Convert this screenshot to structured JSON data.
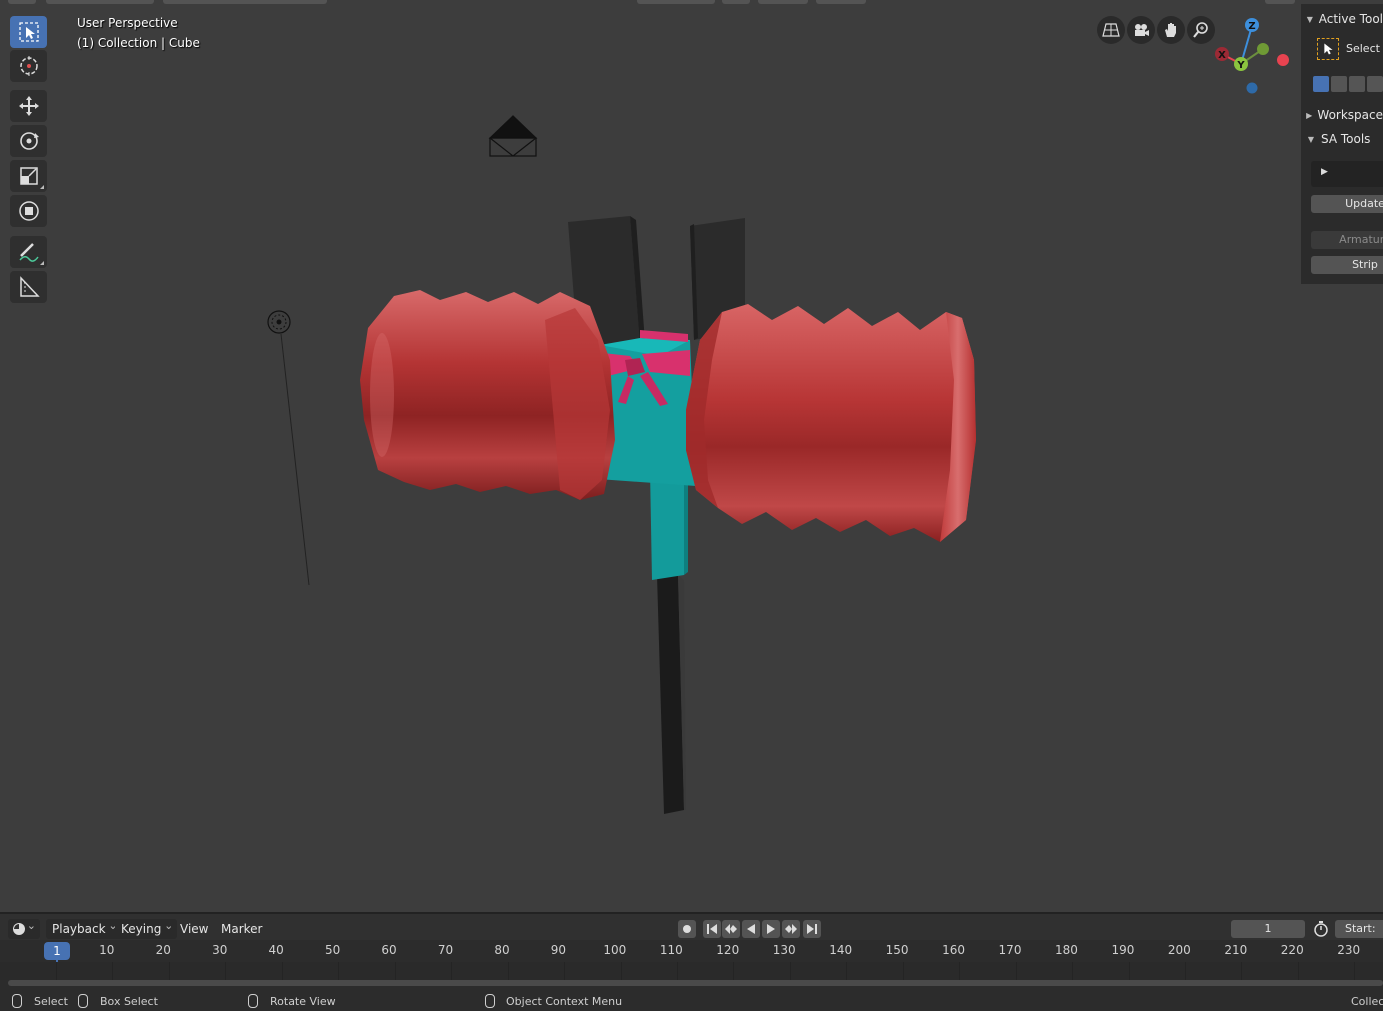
{
  "viewport": {
    "perspective_label": "User Perspective",
    "collection_label": "(1) Collection | Cube",
    "gizmo": {
      "z": "Z",
      "y": "Y",
      "x": "X"
    },
    "colors": {
      "hammer_red": "#c43a3a",
      "handle_teal": "#14a3a3",
      "bow_pink": "#d8316d",
      "ears": "#2a2a2a",
      "x_axis": "#e84350",
      "y_axis": "#8bc43f",
      "z_axis": "#3d8fdc"
    }
  },
  "toolbar": {
    "tools": [
      "select-box-icon",
      "cursor-icon",
      "move-icon",
      "rotate-icon",
      "scale-icon",
      "transform-icon",
      "annotate-icon",
      "measure-icon"
    ]
  },
  "nav_buttons": [
    "grid-toggle-icon",
    "camera-view-icon",
    "pan-hand-icon",
    "zoom-icon"
  ],
  "side_panel": {
    "active_tool_header": "Active Tool",
    "select_label": "Select Box",
    "workspace_header": "Workspace",
    "sa_tools_header": "SA Tools",
    "update_button": "Update",
    "armature_label": "Armature",
    "strip_button": "Strip"
  },
  "timeline": {
    "menus": {
      "playback": "Playback",
      "keying": "Keying",
      "view": "View",
      "marker": "Marker"
    },
    "current_frame": "1",
    "frame_field": "1",
    "start_label": "Start:",
    "ticks": [
      "10",
      "20",
      "30",
      "40",
      "50",
      "60",
      "70",
      "80",
      "90",
      "100",
      "110",
      "120",
      "130",
      "140",
      "150",
      "160",
      "170",
      "180",
      "190",
      "200",
      "210",
      "220",
      "230"
    ]
  },
  "statusbar": {
    "select": "Select",
    "box_select": "Box Select",
    "rotate_view": "Rotate View",
    "context_menu": "Object Context Menu",
    "collection": "Collection | Cube"
  }
}
